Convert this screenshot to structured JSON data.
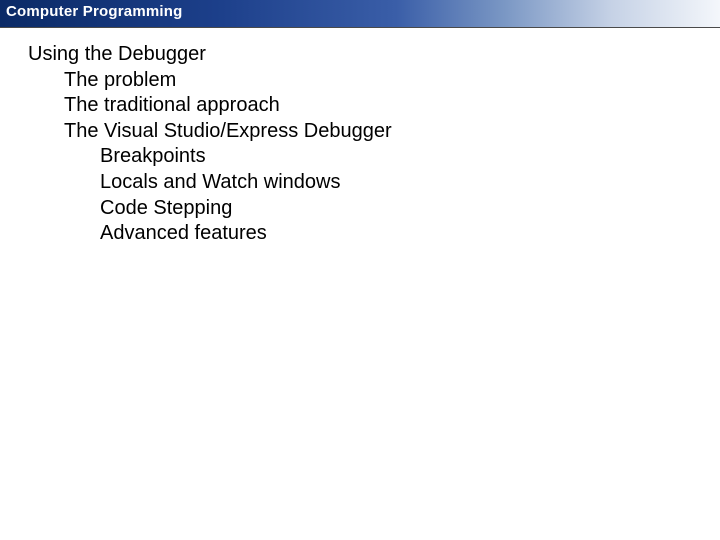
{
  "header": {
    "title": "Computer Programming"
  },
  "outline": {
    "l1_0": "Using the Debugger",
    "l2_0": "The problem",
    "l2_1": "The traditional approach",
    "l2_2": "The Visual Studio/Express Debugger",
    "l3_0": "Breakpoints",
    "l3_1": "Locals and Watch windows",
    "l3_2": "Code Stepping",
    "l3_3": "Advanced features"
  }
}
